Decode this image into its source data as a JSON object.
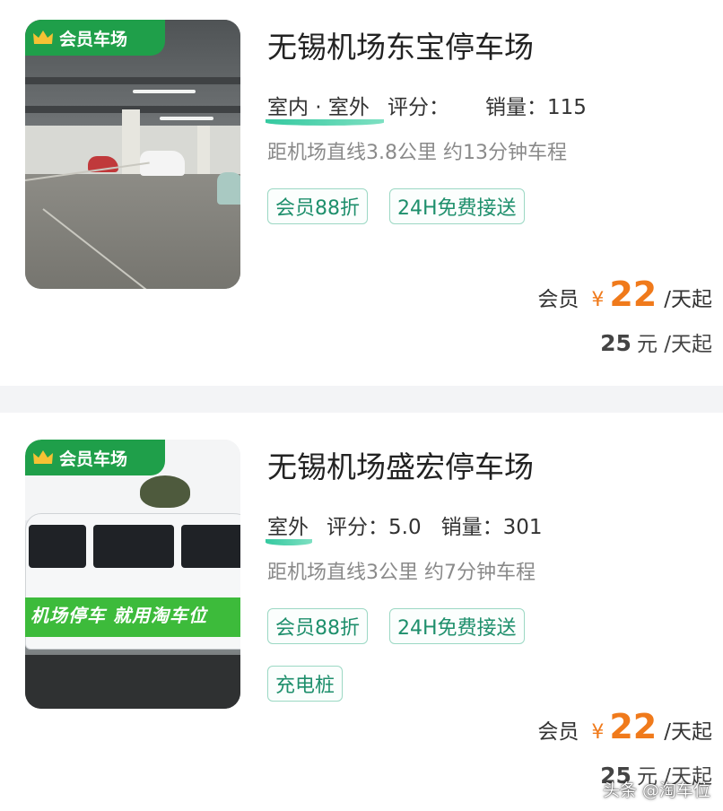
{
  "listings": [
    {
      "badge": "会员车场",
      "title": "无锡机场东宝停车场",
      "type": "室内 · 室外",
      "rating_label": "评分：",
      "rating_value": "",
      "sales_label": "销量：",
      "sales_value": "115",
      "distance": "距机场直线3.8公里 约13分钟车程",
      "tags": [
        "会员88折",
        "24H免费接送"
      ],
      "member_label": "会员",
      "currency": "¥",
      "member_price": "22",
      "per_day": "/天起",
      "regular_price": "25",
      "regular_unit": "元 /天起"
    },
    {
      "badge": "会员车场",
      "title": "无锡机场盛宏停车场",
      "type": "室外",
      "rating_label": "评分：",
      "rating_value": "5.0",
      "sales_label": "销量：",
      "sales_value": "301",
      "distance": "距机场直线3公里 约7分钟车程",
      "tags": [
        "会员88折",
        "24H免费接送",
        "充电桩"
      ],
      "van_text": "机场停车 就用淘车位",
      "member_label": "会员",
      "currency": "¥",
      "member_price": "22",
      "per_day": "/天起",
      "regular_price": "25",
      "regular_unit": "元 /天起"
    }
  ],
  "watermark": "头条 @淘车位",
  "colors": {
    "accent": "#f07a1b",
    "badge": "#1f9f4a",
    "tag": "#1e8f6c"
  }
}
